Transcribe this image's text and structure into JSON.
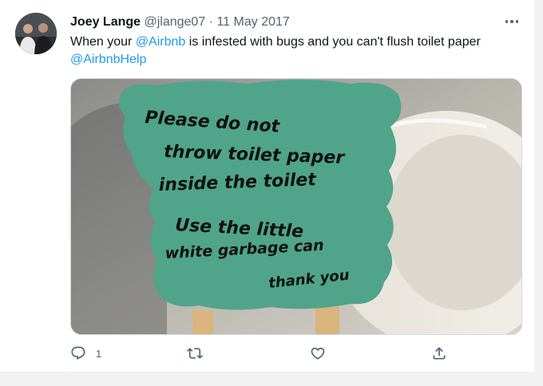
{
  "tweet": {
    "author_name": "Joey Lange",
    "handle": "@jlange07",
    "separator": "·",
    "date": "11 May 2017",
    "text_prefix": "When your ",
    "mention_1": "@Airbnb",
    "text_middle": " is infested with bugs and you can't flush toilet paper",
    "mention_2": "@AirbnbHelp",
    "reply_count": "1"
  },
  "photo": {
    "note_lines": [
      "Please do not",
      "throw toilet paper",
      "inside the toilet",
      "Use the little",
      "white garbage can",
      "thank you"
    ]
  },
  "icons": {
    "more": "more-horizontal-icon",
    "reply": "reply-icon",
    "retweet": "retweet-icon",
    "like": "heart-icon",
    "share": "share-icon"
  },
  "colors": {
    "link": "#1d9bf0",
    "muted": "#536471",
    "note_green": "#4fa48a"
  }
}
